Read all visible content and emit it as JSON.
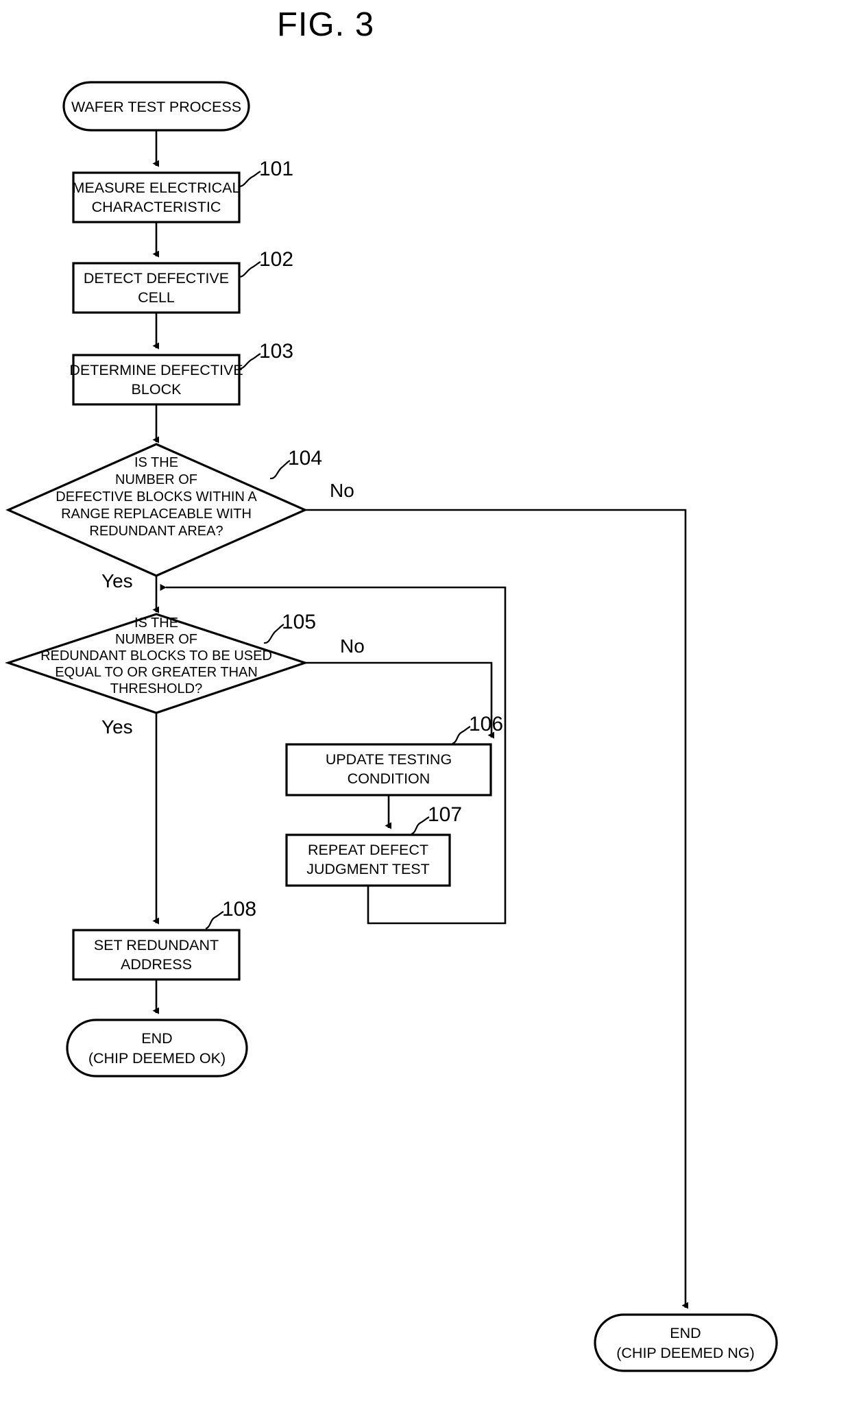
{
  "figure": {
    "title": "FIG. 3",
    "type": "flowchart"
  },
  "nodes": {
    "start": {
      "id": "start",
      "shape": "terminator",
      "lines": [
        "WAFER TEST PROCESS"
      ]
    },
    "step101": {
      "id": "101",
      "shape": "process",
      "ref": "101",
      "lines": [
        "MEASURE ELECTRICAL",
        "CHARACTERISTIC"
      ]
    },
    "step102": {
      "id": "102",
      "shape": "process",
      "ref": "102",
      "lines": [
        "DETECT DEFECTIVE",
        "CELL"
      ]
    },
    "step103": {
      "id": "103",
      "shape": "process",
      "ref": "103",
      "lines": [
        "DETERMINE DEFECTIVE",
        "BLOCK"
      ]
    },
    "step104": {
      "id": "104",
      "shape": "decision",
      "ref": "104",
      "lines": [
        "IS THE",
        "NUMBER OF",
        "DEFECTIVE BLOCKS WITHIN A",
        "RANGE REPLACEABLE WITH",
        "REDUNDANT AREA?"
      ],
      "yes_label": "Yes",
      "no_label": "No"
    },
    "step105": {
      "id": "105",
      "shape": "decision",
      "ref": "105",
      "lines": [
        "IS THE",
        "NUMBER OF",
        "REDUNDANT BLOCKS TO BE USED",
        "EQUAL TO OR GREATER THAN",
        "THRESHOLD?"
      ],
      "yes_label": "Yes",
      "no_label": "No"
    },
    "step106": {
      "id": "106",
      "shape": "process",
      "ref": "106",
      "lines": [
        "UPDATE TESTING",
        "CONDITION"
      ]
    },
    "step107": {
      "id": "107",
      "shape": "process",
      "ref": "107",
      "lines": [
        "REPEAT DEFECT",
        "JUDGMENT TEST"
      ]
    },
    "step108": {
      "id": "108",
      "shape": "process",
      "ref": "108",
      "lines": [
        "SET REDUNDANT",
        "ADDRESS"
      ]
    },
    "end_ok": {
      "id": "end_ok",
      "shape": "terminator",
      "lines": [
        "END",
        "(CHIP DEEMED OK)"
      ]
    },
    "end_ng": {
      "id": "end_ng",
      "shape": "terminator",
      "lines": [
        "END",
        "(CHIP DEEMED NG)"
      ]
    }
  },
  "edges": [
    {
      "from": "start",
      "to": "step101",
      "label": ""
    },
    {
      "from": "step101",
      "to": "step102",
      "label": ""
    },
    {
      "from": "step102",
      "to": "step103",
      "label": ""
    },
    {
      "from": "step103",
      "to": "step104",
      "label": ""
    },
    {
      "from": "step104",
      "to": "step105",
      "label": "Yes"
    },
    {
      "from": "step104",
      "to": "end_ng",
      "label": "No"
    },
    {
      "from": "step105",
      "to": "step108",
      "label": "Yes"
    },
    {
      "from": "step105",
      "to": "step106",
      "label": "No"
    },
    {
      "from": "step106",
      "to": "step107",
      "label": ""
    },
    {
      "from": "step107",
      "to": "step105",
      "label": ""
    },
    {
      "from": "step108",
      "to": "end_ok",
      "label": ""
    }
  ],
  "colors": {
    "stroke": "#000000",
    "fill": "#ffffff",
    "background": "#ffffff"
  }
}
